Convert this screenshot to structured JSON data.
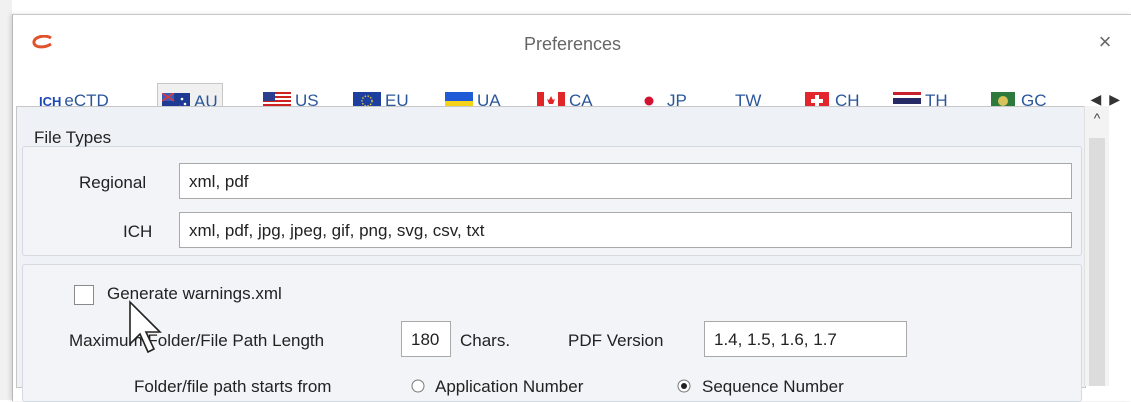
{
  "window": {
    "title": "Preferences",
    "close_glyph": "×"
  },
  "tabs": [
    {
      "label": "eCTD",
      "badge": "ICH"
    },
    {
      "label": "AU",
      "active": true
    },
    {
      "label": "US"
    },
    {
      "label": "EU"
    },
    {
      "label": "UA"
    },
    {
      "label": "CA"
    },
    {
      "label": "JP"
    },
    {
      "label": "TW"
    },
    {
      "label": "CH"
    },
    {
      "label": "TH"
    },
    {
      "label": "GC"
    }
  ],
  "tab_scroll": {
    "left": "◀",
    "right": "▶"
  },
  "scroll_up_glyph": "^",
  "file_types": {
    "title": "File Types",
    "regional_label": "Regional",
    "regional_value": "xml, pdf",
    "ich_label": "ICH",
    "ich_value": "xml, pdf, jpg, jpeg, gif, png, svg, csv, txt"
  },
  "options": {
    "generate_warnings_label": "Generate warnings.xml",
    "generate_warnings_checked": false,
    "max_path_label": "Maximum Folder/File Path Length",
    "max_path_value": "180",
    "chars_label": "Chars.",
    "pdf_version_label": "PDF Version",
    "pdf_version_value": "1.4, 1.5, 1.6, 1.7",
    "path_starts_label": "Folder/file path starts from",
    "radio_application": "Application Number",
    "radio_sequence": "Sequence Number",
    "selected_radio": "Sequence Number"
  },
  "colors": {
    "accent": "#2b579a",
    "panel": "#eef1f5",
    "logo": "#e0522b"
  }
}
